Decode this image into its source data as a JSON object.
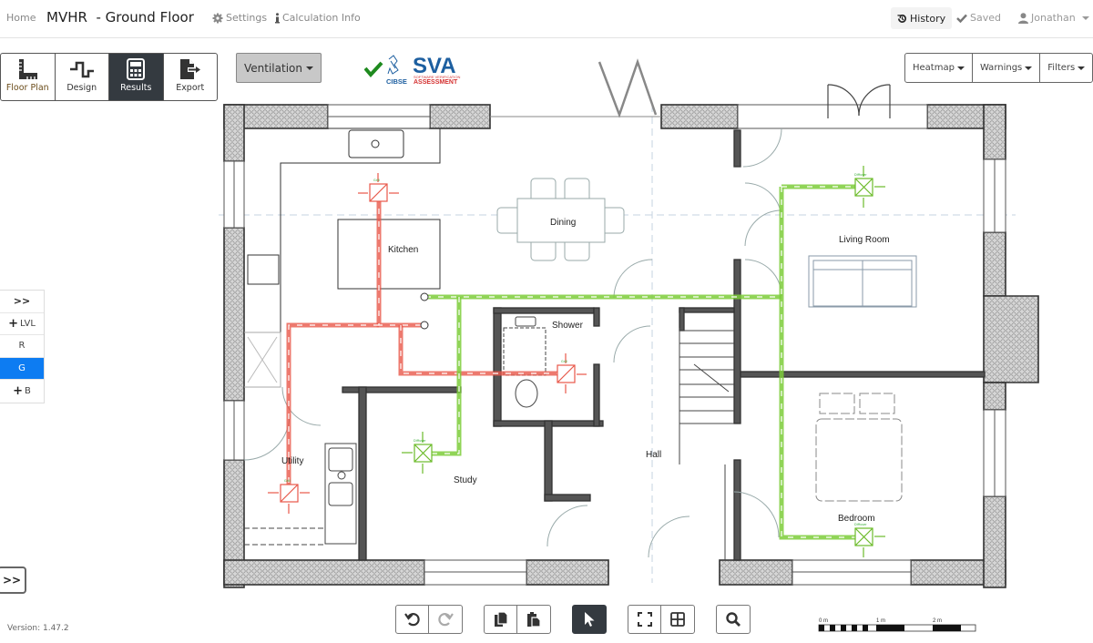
{
  "header": {
    "home": "Home",
    "project": "MVHR",
    "floor": "  - Ground Floor",
    "settings": "Settings",
    "calc_info": "Calculation Info",
    "history": "History",
    "saved": "Saved",
    "user": "Jonathan"
  },
  "modes": [
    {
      "label": "Floor Plan",
      "icon": "ruler-icon",
      "active": false
    },
    {
      "label": "Design",
      "icon": "duct-path-icon",
      "active": false
    },
    {
      "label": "Results",
      "icon": "calculator-icon",
      "active": true
    },
    {
      "label": "Export",
      "icon": "export-icon",
      "active": false
    }
  ],
  "system_dropdown": "Ventilation",
  "certification": {
    "top": "SVA",
    "sub1": "SOFTWARE VERIFICATION",
    "sub2": "ASSESSMENT",
    "org": "CIBSE",
    "check_color": "#1e8a1e"
  },
  "view_options": [
    "Heatmap",
    "Warnings",
    "Filters"
  ],
  "levels": {
    "expand": ">>",
    "add_top": "LVL",
    "items": [
      "R",
      "G"
    ],
    "active": "G",
    "add_bottom": "B"
  },
  "panel_toggle": ">>",
  "version": "Version: 1.47.2",
  "floorplan": {
    "rooms": [
      "Kitchen",
      "Dining",
      "Living Room",
      "Shower",
      "Utility",
      "Study",
      "Hall",
      "Bedroom"
    ],
    "terminals": [
      {
        "room": "Kitchen",
        "type": "Grill",
        "system": "extract"
      },
      {
        "room": "Shower",
        "type": "Grill",
        "system": "extract"
      },
      {
        "room": "Utility",
        "type": "Grill",
        "system": "extract"
      },
      {
        "room": "Study",
        "type": "Diffuser",
        "system": "supply"
      },
      {
        "room": "Living Room",
        "type": "Diffuser",
        "system": "supply"
      },
      {
        "room": "Bedroom",
        "type": "Diffuser",
        "system": "supply"
      }
    ],
    "colors": {
      "extract": "#e8584a",
      "supply": "#7ccc3a",
      "wall": "#333333"
    }
  },
  "bottom_toolbar": {
    "undo": "undo-icon",
    "redo": "redo-icon",
    "copy": "copy-icon",
    "paste": "paste-icon",
    "select": "pointer-icon",
    "fit": "fit-screen-icon",
    "grid": "grid-icon",
    "search": "zoom-icon"
  },
  "scale_bar": {
    "labels": [
      "0 m",
      "1 m",
      "2 m"
    ]
  }
}
